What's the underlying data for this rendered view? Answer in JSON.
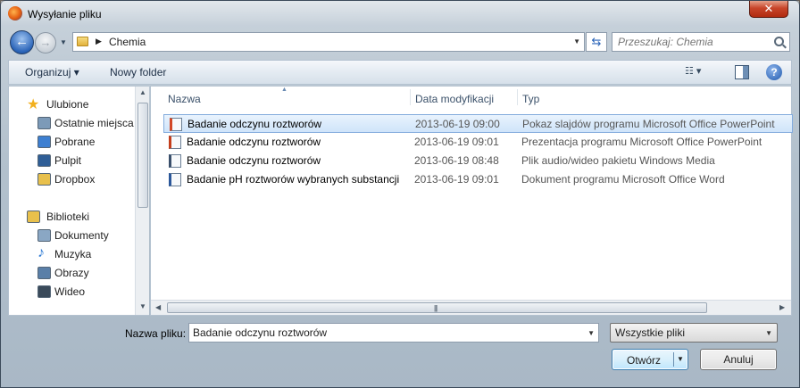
{
  "window": {
    "title": "Wysyłanie pliku",
    "close_label": "✕"
  },
  "address": {
    "path": "Chemia"
  },
  "search": {
    "placeholder": "Przeszukaj: Chemia"
  },
  "toolbar": {
    "organize_label": "Organizuj ▾",
    "new_folder_label": "Nowy folder",
    "view_label": "☷ ▾",
    "help_label": "?"
  },
  "nav": {
    "items": [
      {
        "label": "Ulubione",
        "icon": "star-icon",
        "color": "#f2b01e"
      },
      {
        "label": "Ostatnie miejsca",
        "icon": "recent-places-icon",
        "color": "#7c9ab8"
      },
      {
        "label": "Pobrane",
        "icon": "downloads-folder-icon",
        "color": "#3d7fd1"
      },
      {
        "label": "Pulpit",
        "icon": "desktop-icon",
        "color": "#2f5e96"
      },
      {
        "label": "Dropbox",
        "icon": "folder-icon",
        "color": "#e8c04c"
      },
      {
        "label": "Biblioteki",
        "icon": "libraries-icon",
        "color": "#e8c04c"
      },
      {
        "label": "Dokumenty",
        "icon": "documents-icon",
        "color": "#8aa7c4"
      },
      {
        "label": "Muzyka",
        "icon": "music-icon",
        "color": "#2f7bd4"
      },
      {
        "label": "Obrazy",
        "icon": "pictures-icon",
        "color": "#5a7fa8"
      },
      {
        "label": "Wideo",
        "icon": "video-icon",
        "color": "#3a4a5a"
      }
    ]
  },
  "files": {
    "columns": [
      "Nazwa",
      "Data modyfikacji",
      "Typ"
    ],
    "rows": [
      {
        "name": "Badanie odczynu roztworów",
        "date": "2013-06-19 09:00",
        "type": "Pokaz slajdów programu Microsoft Office PowerPoint",
        "icon": "powerpoint-show-icon",
        "selected": true
      },
      {
        "name": "Badanie odczynu roztworów",
        "date": "2013-06-19 09:01",
        "type": "Prezentacja programu Microsoft Office PowerPoint",
        "icon": "powerpoint-icon",
        "selected": false
      },
      {
        "name": "Badanie odczynu roztworów",
        "date": "2013-06-19 08:48",
        "type": "Plik audio/wideo pakietu Windows Media",
        "icon": "media-file-icon",
        "selected": false
      },
      {
        "name": "Badanie pH roztworów wybranych substancji",
        "date": "2013-06-19 09:01",
        "type": "Dokument programu Microsoft Office Word",
        "icon": "word-document-icon",
        "selected": false
      }
    ]
  },
  "footer": {
    "filename_label": "Nazwa pliku:",
    "filename_value": "Badanie odczynu roztworów",
    "filter_value": "Wszystkie pliki",
    "open_label": "Otwórz",
    "cancel_label": "Anuluj"
  }
}
